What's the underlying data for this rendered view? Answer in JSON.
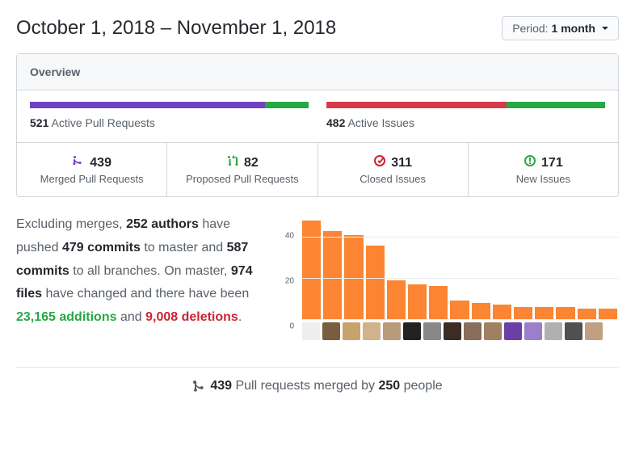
{
  "header": {
    "date_range": "October 1, 2018 – November 1, 2018",
    "period_label": "Period:",
    "period_value": "1 month"
  },
  "overview": {
    "title": "Overview",
    "pr_bar": {
      "merged_pct": 84.3,
      "proposed_pct": 15.7,
      "merged_color": "#6f42c1",
      "proposed_color": "#28a745",
      "count": "521",
      "text": "Active Pull Requests"
    },
    "issue_bar": {
      "closed_pct": 64.5,
      "open_pct": 35.5,
      "closed_color": "#d73a49",
      "open_color": "#28a745",
      "count": "482",
      "text": "Active Issues"
    },
    "cells": [
      {
        "icon": "merge",
        "color": "#6f42c1",
        "value": "439",
        "desc": "Merged Pull Requests"
      },
      {
        "icon": "pr",
        "color": "#28a745",
        "value": "82",
        "desc": "Proposed Pull Requests"
      },
      {
        "icon": "closed",
        "color": "#cb2431",
        "value": "311",
        "desc": "Closed Issues"
      },
      {
        "icon": "open",
        "color": "#28a745",
        "value": "171",
        "desc": "New Issues"
      }
    ]
  },
  "summary": {
    "text_parts": {
      "p1": "Excluding merges, ",
      "authors": "252 authors",
      "p2": " have pushed ",
      "commits_master": "479 commits",
      "p3": " to master and ",
      "commits_all": "587 commits",
      "p4": " to all branches. On master, ",
      "files": "974 files",
      "p5": " have changed and there have been ",
      "additions": "23,165 additions",
      "p6": " and ",
      "deletions": "9,008 deletions",
      "p7": "."
    }
  },
  "chart_data": {
    "type": "bar",
    "ylim": [
      0,
      50
    ],
    "yticks": [
      "0",
      "20",
      "40"
    ],
    "values": [
      48,
      43,
      41,
      36,
      19,
      17,
      16,
      9,
      8,
      7,
      6,
      6,
      6,
      5,
      5
    ],
    "avatars": [
      "#eee",
      "#7a5c3e",
      "#c7a36b",
      "#d0b28c",
      "#b89b7a",
      "#222",
      "#888",
      "#3b2d23",
      "#8a6d5a",
      "#a08060",
      "#6c3fa6",
      "#9b7fca",
      "#b0b0b0",
      "#505050",
      "#c0a080"
    ]
  },
  "footer": {
    "count": "439",
    "mid": " Pull requests merged by ",
    "people": "250",
    "tail": " people"
  }
}
